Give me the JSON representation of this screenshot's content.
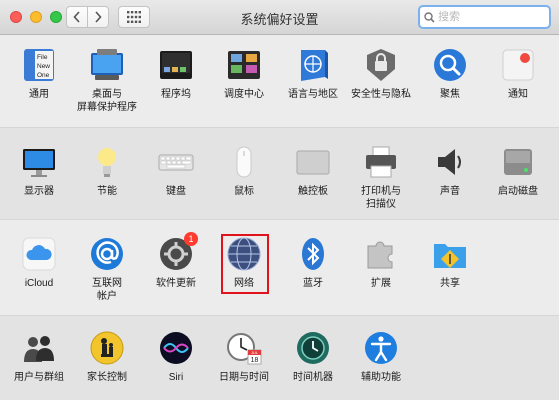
{
  "window": {
    "title": "系统偏好设置",
    "search_placeholder": "搜索"
  },
  "sections": [
    {
      "items": [
        {
          "id": "general",
          "label": "通用",
          "icon": "general-icon"
        },
        {
          "id": "desktop",
          "label": "桌面与\n屏幕保护程序",
          "icon": "desktop-screensaver-icon"
        },
        {
          "id": "dock",
          "label": "程序坞",
          "icon": "dock-icon"
        },
        {
          "id": "mission",
          "label": "调度中心",
          "icon": "mission-control-icon"
        },
        {
          "id": "language",
          "label": "语言与地区",
          "icon": "language-region-icon"
        },
        {
          "id": "security",
          "label": "安全性与隐私",
          "icon": "security-privacy-icon"
        },
        {
          "id": "spotlight",
          "label": "聚焦",
          "icon": "spotlight-icon"
        },
        {
          "id": "notifications",
          "label": "通知",
          "icon": "notifications-icon"
        }
      ]
    },
    {
      "items": [
        {
          "id": "displays",
          "label": "显示器",
          "icon": "displays-icon"
        },
        {
          "id": "energy",
          "label": "节能",
          "icon": "energy-saver-icon"
        },
        {
          "id": "keyboard",
          "label": "键盘",
          "icon": "keyboard-icon"
        },
        {
          "id": "mouse",
          "label": "鼠标",
          "icon": "mouse-icon"
        },
        {
          "id": "trackpad",
          "label": "触控板",
          "icon": "trackpad-icon"
        },
        {
          "id": "printers",
          "label": "打印机与\n扫描仪",
          "icon": "printers-scanners-icon"
        },
        {
          "id": "sound",
          "label": "声音",
          "icon": "sound-icon"
        },
        {
          "id": "startup",
          "label": "启动磁盘",
          "icon": "startup-disk-icon"
        }
      ]
    },
    {
      "items": [
        {
          "id": "icloud",
          "label": "iCloud",
          "icon": "icloud-icon"
        },
        {
          "id": "internet",
          "label": "互联网\n帐户",
          "icon": "internet-accounts-icon"
        },
        {
          "id": "update",
          "label": "软件更新",
          "icon": "software-update-icon",
          "badge": "1"
        },
        {
          "id": "network",
          "label": "网络",
          "icon": "network-icon"
        },
        {
          "id": "bluetooth",
          "label": "蓝牙",
          "icon": "bluetooth-icon"
        },
        {
          "id": "extensions",
          "label": "扩展",
          "icon": "extensions-icon"
        },
        {
          "id": "sharing",
          "label": "共享",
          "icon": "sharing-icon"
        }
      ]
    },
    {
      "items": [
        {
          "id": "users",
          "label": "用户与群组",
          "icon": "users-groups-icon"
        },
        {
          "id": "parental",
          "label": "家长控制",
          "icon": "parental-controls-icon"
        },
        {
          "id": "siri",
          "label": "Siri",
          "icon": "siri-icon"
        },
        {
          "id": "datetime",
          "label": "日期与时间",
          "icon": "date-time-icon"
        },
        {
          "id": "timemachine",
          "label": "时间机器",
          "icon": "time-machine-icon"
        },
        {
          "id": "accessibility",
          "label": "辅助功能",
          "icon": "accessibility-icon"
        }
      ]
    }
  ],
  "icon_texts": {
    "general": [
      "File",
      "New",
      "One"
    ],
    "calendar_month": "JUL",
    "calendar_day": "18"
  },
  "colors": {
    "highlight": "#e0121a",
    "search_focus": "#7ab1ee",
    "badge": "#ff3b30"
  }
}
